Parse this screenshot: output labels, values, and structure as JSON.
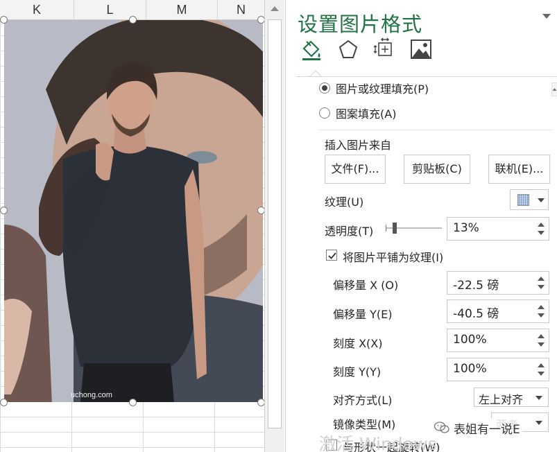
{
  "sheet": {
    "columns": [
      "K",
      "L",
      "M",
      "N"
    ],
    "image_caption": "uchong.com"
  },
  "pane": {
    "title": "设置图片格式",
    "tabs": [
      {
        "icon": "fill-line-icon"
      },
      {
        "icon": "effects-pentagon-icon"
      },
      {
        "icon": "size-properties-icon"
      },
      {
        "icon": "picture-icon"
      }
    ],
    "fill": {
      "picture_texture_fill": "图片或纹理填充(P)",
      "pattern_fill": "图案填充(A)",
      "insert_from": "插入图片来自",
      "buttons": {
        "file": "文件(F)...",
        "clipboard": "剪贴板(C)",
        "online": "联机(E)..."
      },
      "texture_label": "纹理(U)",
      "transparency_label": "透明度(T)",
      "transparency_value": "13%",
      "tile_label": "将图片平铺为纹理(I)",
      "offset_x_label": "偏移量 X (O)",
      "offset_x_value": "-22.5 磅",
      "offset_y_label": "偏移量 Y(E)",
      "offset_y_value": "-40.5 磅",
      "scale_x_label": "刻度 X(X)",
      "scale_x_value": "100%",
      "scale_y_label": "刻度 Y(Y)",
      "scale_y_value": "100%",
      "alignment_label": "对齐方式(L)",
      "alignment_value": "左上对齐",
      "mirror_label": "镜像类型(M)",
      "mirror_value": "两者",
      "rotate_label": "与形状一起旋转(W)"
    }
  },
  "overlay": {
    "windows_watermark": "激活 Windows",
    "brand_text": "表姐有一说E"
  },
  "colors": {
    "accent": "#217346",
    "photo_background": "#b7bac4",
    "shirt": "#2b2f36"
  }
}
